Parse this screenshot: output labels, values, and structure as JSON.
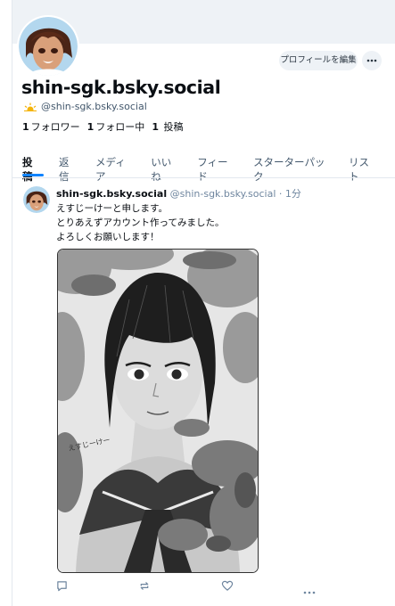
{
  "profile": {
    "handle_title": "shin-sgk.bsky.social",
    "handle": "@shin-sgk.bsky.social",
    "edit_button": "プロフィールを編集",
    "stats": {
      "followers_count": "1",
      "followers_label": "フォロワー",
      "following_count": "1",
      "following_label": "フォロー中",
      "posts_count": "1",
      "posts_label": "投稿"
    }
  },
  "tabs": [
    "投稿",
    "返信",
    "メディア",
    "いいね",
    "フィード",
    "スターターパック",
    "リスト"
  ],
  "post": {
    "author_name": "shin-sgk.bsky.social",
    "author_handle": "@shin-sgk.bsky.social",
    "time": "1分",
    "lines": [
      "えすじーけーと申します。",
      "とりあえずアカウント作ってみました。",
      "よろしくお願いします！"
    ],
    "signature": "えすじーけー"
  },
  "icons": [
    "ellipsis-icon",
    "sun-badge-icon",
    "reply-icon",
    "repost-icon",
    "like-icon",
    "more-icon"
  ],
  "colors": {
    "accent": "#1083fe",
    "muted": "#42576c",
    "banner": "#eef2f6"
  }
}
